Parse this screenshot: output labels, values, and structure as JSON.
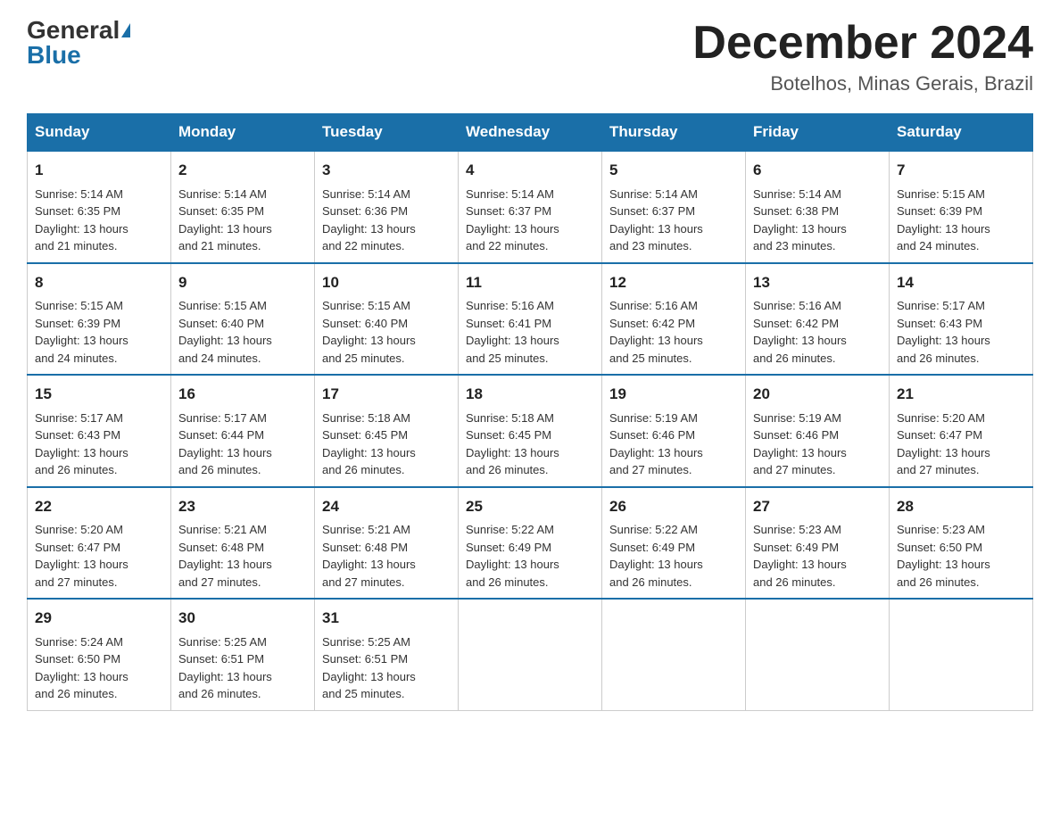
{
  "logo": {
    "general": "General",
    "blue": "Blue"
  },
  "title": {
    "month": "December 2024",
    "location": "Botelhos, Minas Gerais, Brazil"
  },
  "weekdays": [
    "Sunday",
    "Monday",
    "Tuesday",
    "Wednesday",
    "Thursday",
    "Friday",
    "Saturday"
  ],
  "weeks": [
    [
      {
        "day": "1",
        "sunrise": "5:14 AM",
        "sunset": "6:35 PM",
        "daylight": "13 hours and 21 minutes."
      },
      {
        "day": "2",
        "sunrise": "5:14 AM",
        "sunset": "6:35 PM",
        "daylight": "13 hours and 21 minutes."
      },
      {
        "day": "3",
        "sunrise": "5:14 AM",
        "sunset": "6:36 PM",
        "daylight": "13 hours and 22 minutes."
      },
      {
        "day": "4",
        "sunrise": "5:14 AM",
        "sunset": "6:37 PM",
        "daylight": "13 hours and 22 minutes."
      },
      {
        "day": "5",
        "sunrise": "5:14 AM",
        "sunset": "6:37 PM",
        "daylight": "13 hours and 23 minutes."
      },
      {
        "day": "6",
        "sunrise": "5:14 AM",
        "sunset": "6:38 PM",
        "daylight": "13 hours and 23 minutes."
      },
      {
        "day": "7",
        "sunrise": "5:15 AM",
        "sunset": "6:39 PM",
        "daylight": "13 hours and 24 minutes."
      }
    ],
    [
      {
        "day": "8",
        "sunrise": "5:15 AM",
        "sunset": "6:39 PM",
        "daylight": "13 hours and 24 minutes."
      },
      {
        "day": "9",
        "sunrise": "5:15 AM",
        "sunset": "6:40 PM",
        "daylight": "13 hours and 24 minutes."
      },
      {
        "day": "10",
        "sunrise": "5:15 AM",
        "sunset": "6:40 PM",
        "daylight": "13 hours and 25 minutes."
      },
      {
        "day": "11",
        "sunrise": "5:16 AM",
        "sunset": "6:41 PM",
        "daylight": "13 hours and 25 minutes."
      },
      {
        "day": "12",
        "sunrise": "5:16 AM",
        "sunset": "6:42 PM",
        "daylight": "13 hours and 25 minutes."
      },
      {
        "day": "13",
        "sunrise": "5:16 AM",
        "sunset": "6:42 PM",
        "daylight": "13 hours and 26 minutes."
      },
      {
        "day": "14",
        "sunrise": "5:17 AM",
        "sunset": "6:43 PM",
        "daylight": "13 hours and 26 minutes."
      }
    ],
    [
      {
        "day": "15",
        "sunrise": "5:17 AM",
        "sunset": "6:43 PM",
        "daylight": "13 hours and 26 minutes."
      },
      {
        "day": "16",
        "sunrise": "5:17 AM",
        "sunset": "6:44 PM",
        "daylight": "13 hours and 26 minutes."
      },
      {
        "day": "17",
        "sunrise": "5:18 AM",
        "sunset": "6:45 PM",
        "daylight": "13 hours and 26 minutes."
      },
      {
        "day": "18",
        "sunrise": "5:18 AM",
        "sunset": "6:45 PM",
        "daylight": "13 hours and 26 minutes."
      },
      {
        "day": "19",
        "sunrise": "5:19 AM",
        "sunset": "6:46 PM",
        "daylight": "13 hours and 27 minutes."
      },
      {
        "day": "20",
        "sunrise": "5:19 AM",
        "sunset": "6:46 PM",
        "daylight": "13 hours and 27 minutes."
      },
      {
        "day": "21",
        "sunrise": "5:20 AM",
        "sunset": "6:47 PM",
        "daylight": "13 hours and 27 minutes."
      }
    ],
    [
      {
        "day": "22",
        "sunrise": "5:20 AM",
        "sunset": "6:47 PM",
        "daylight": "13 hours and 27 minutes."
      },
      {
        "day": "23",
        "sunrise": "5:21 AM",
        "sunset": "6:48 PM",
        "daylight": "13 hours and 27 minutes."
      },
      {
        "day": "24",
        "sunrise": "5:21 AM",
        "sunset": "6:48 PM",
        "daylight": "13 hours and 27 minutes."
      },
      {
        "day": "25",
        "sunrise": "5:22 AM",
        "sunset": "6:49 PM",
        "daylight": "13 hours and 26 minutes."
      },
      {
        "day": "26",
        "sunrise": "5:22 AM",
        "sunset": "6:49 PM",
        "daylight": "13 hours and 26 minutes."
      },
      {
        "day": "27",
        "sunrise": "5:23 AM",
        "sunset": "6:49 PM",
        "daylight": "13 hours and 26 minutes."
      },
      {
        "day": "28",
        "sunrise": "5:23 AM",
        "sunset": "6:50 PM",
        "daylight": "13 hours and 26 minutes."
      }
    ],
    [
      {
        "day": "29",
        "sunrise": "5:24 AM",
        "sunset": "6:50 PM",
        "daylight": "13 hours and 26 minutes."
      },
      {
        "day": "30",
        "sunrise": "5:25 AM",
        "sunset": "6:51 PM",
        "daylight": "13 hours and 26 minutes."
      },
      {
        "day": "31",
        "sunrise": "5:25 AM",
        "sunset": "6:51 PM",
        "daylight": "13 hours and 25 minutes."
      },
      null,
      null,
      null,
      null
    ]
  ],
  "labels": {
    "sunrise": "Sunrise:",
    "sunset": "Sunset:",
    "daylight": "Daylight:"
  }
}
